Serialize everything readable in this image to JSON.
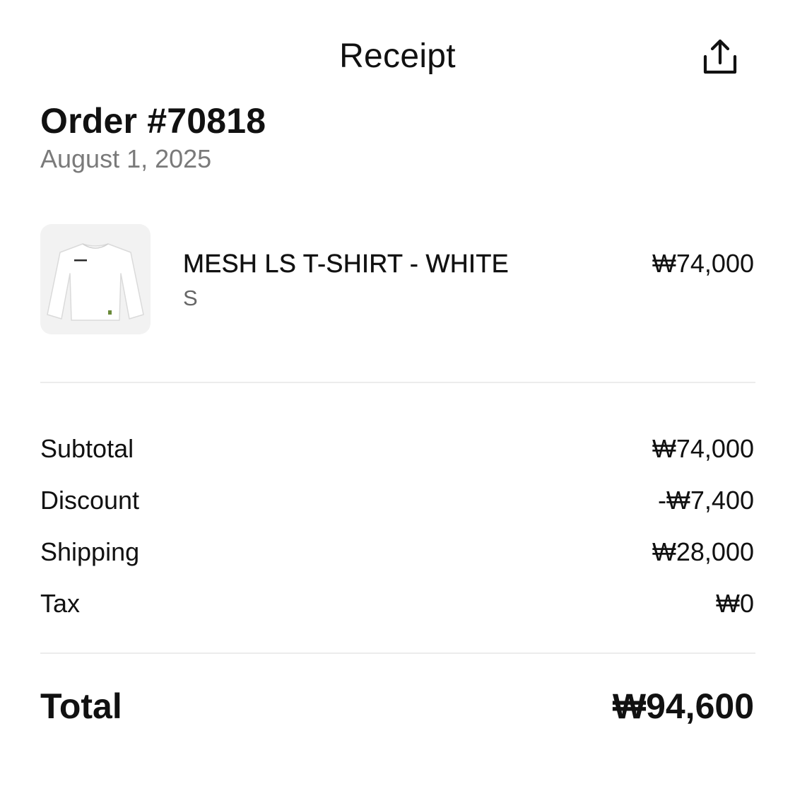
{
  "header": {
    "title": "Receipt",
    "share_icon": "share-icon"
  },
  "order": {
    "number": "Order #70818",
    "date": "August 1, 2025"
  },
  "items": [
    {
      "name": "MESH LS T-SHIRT - WHITE",
      "variant": "S",
      "price": "₩74,000",
      "thumbnail_icon": "white-long-sleeve-tshirt"
    }
  ],
  "summary": {
    "subtotal": {
      "label": "Subtotal",
      "value": "₩74,000"
    },
    "discount": {
      "label": "Discount",
      "value": "-₩7,400"
    },
    "shipping": {
      "label": "Shipping",
      "value": "₩28,000"
    },
    "tax": {
      "label": "Tax",
      "value": "₩0"
    }
  },
  "total": {
    "label": "Total",
    "value": "₩94,600"
  },
  "colors": {
    "text_primary": "#111111",
    "text_secondary": "#7a7a7a",
    "divider": "#ececec",
    "thumb_bg": "#f2f2f2"
  }
}
